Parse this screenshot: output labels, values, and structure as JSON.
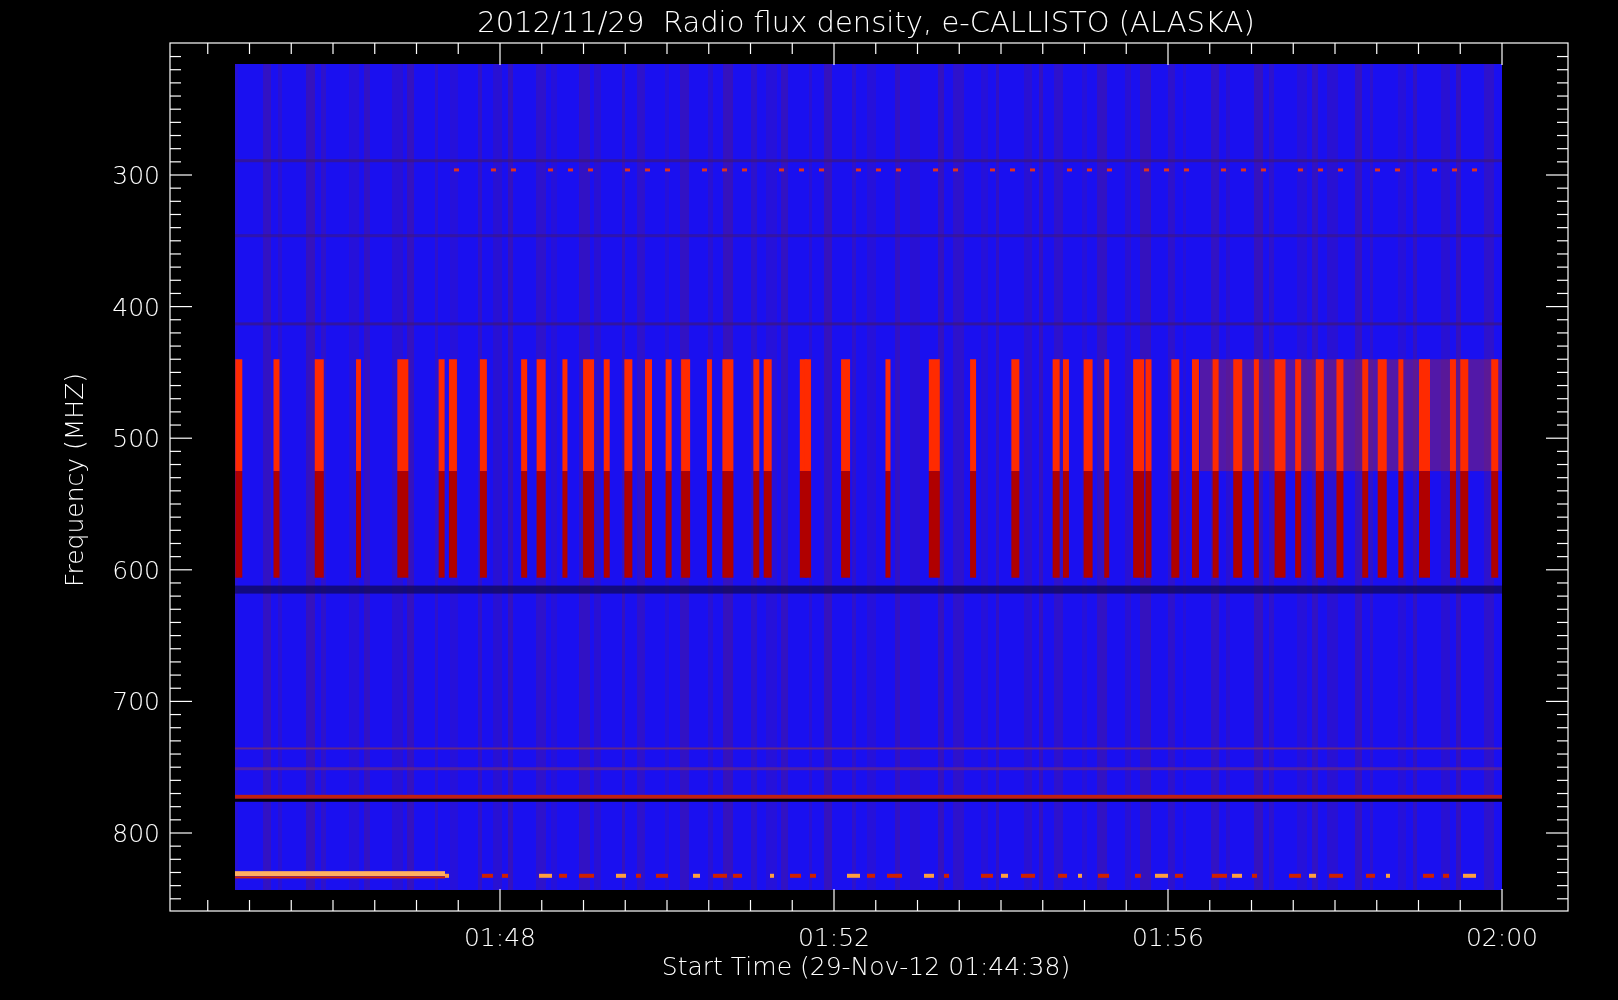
{
  "title": "2012/11/29  Radio flux density, e-CALLISTO (ALASKA)",
  "y_axis": {
    "label": "Frequency (MHZ)",
    "ticks": [
      "300",
      "400",
      "500",
      "600",
      "700",
      "800"
    ]
  },
  "x_axis": {
    "label": "Start Time (29-Nov-12 01:44:38)",
    "ticks": [
      "01:48",
      "01:52",
      "01:56",
      "02:00"
    ]
  }
}
